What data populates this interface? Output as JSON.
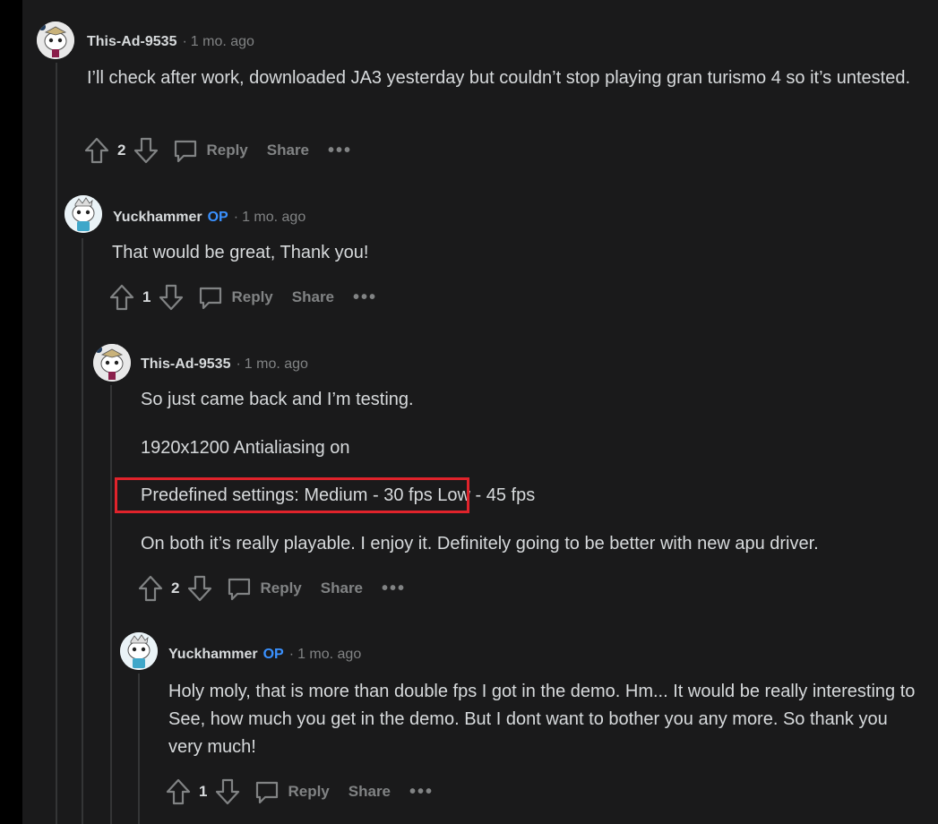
{
  "comments": [
    {
      "author": "This-Ad-9535",
      "op": "",
      "time": "1 mo. ago",
      "paragraphs": [
        "I’ll check after work, downloaded JA3 yesterday but couldn’t stop playing gran turismo 4 so it’s untested."
      ],
      "votes": "2",
      "avatar_icon": "snoo-avatar-icon"
    },
    {
      "author": "Yuckhammer",
      "op": "OP",
      "time": "1 mo. ago",
      "paragraphs": [
        "That would be great, Thank you!"
      ],
      "votes": "1",
      "avatar_icon": "snoo-avatar-icon"
    },
    {
      "author": "This-Ad-9535",
      "op": "",
      "time": "1 mo. ago",
      "paragraphs": [
        "So just came back and I’m testing.",
        "1920x1200 Antialiasing on",
        "Predefined settings: Medium - 30 fps Low - 45 fps",
        "On both it’s really playable. I enjoy it. Definitely going to be better with new apu driver."
      ],
      "votes": "2",
      "avatar_icon": "snoo-avatar-icon"
    },
    {
      "author": "Yuckhammer",
      "op": "OP",
      "time": "1 mo. ago",
      "paragraphs": [
        "Holy moly, that is more than double fps I got in the demo. Hm... It would be really interesting to See, how much you get in the demo. But I dont want to bother you any more. So thank you very much!"
      ],
      "votes": "1",
      "avatar_icon": "snoo-avatar-icon"
    }
  ],
  "labels": {
    "reply": "Reply",
    "share": "Share",
    "more": "•••",
    "separator": "·"
  },
  "highlight": {
    "color": "#e0232b",
    "text": "Predefined settings: Medium - 30 fps"
  },
  "colors": {
    "op_badge": "#3a91ff",
    "background": "#1a1a1b",
    "text": "#d7dadc",
    "muted": "#818384"
  }
}
